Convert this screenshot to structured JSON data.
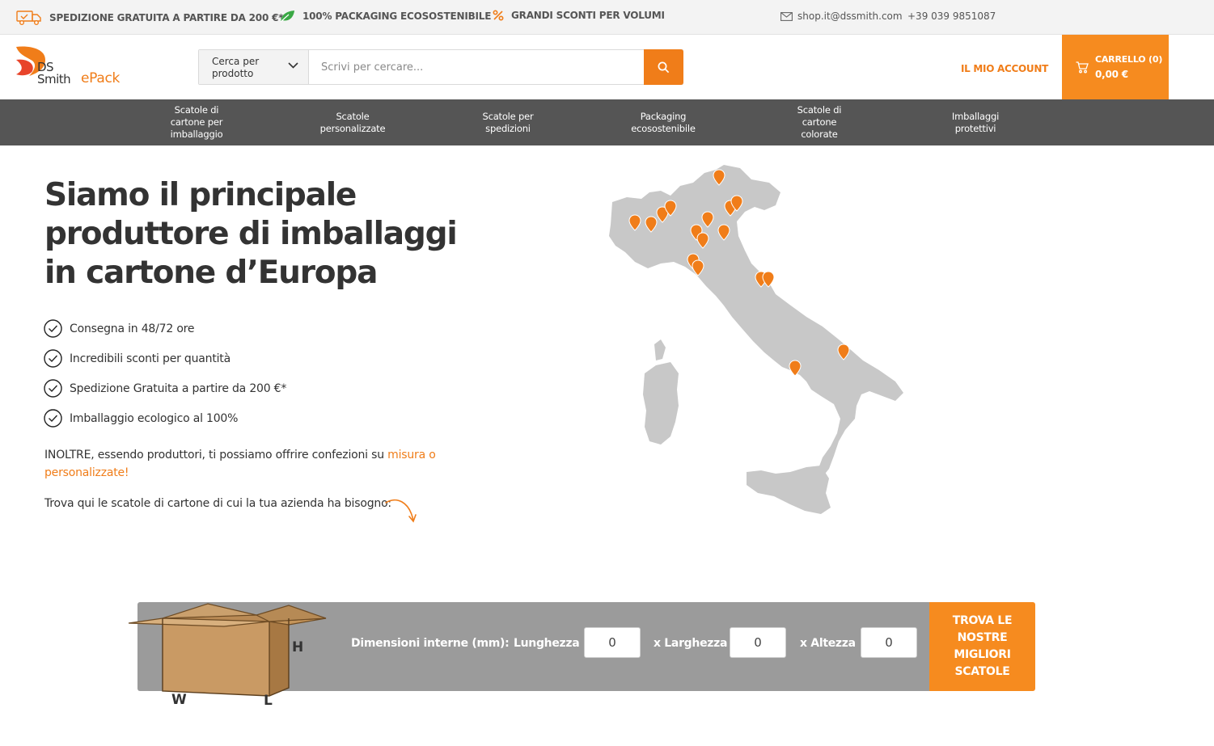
{
  "topbar": {
    "shipping": "SPEDIZIONE GRATUITA A PARTIRE DA 200 €*",
    "eco": "100% PACKAGING ECOSOSTENIBILE",
    "discount": "GRANDI SCONTI PER VOLUMI",
    "email": "shop.it@dssmith.com",
    "phone": "+39 039 9851087"
  },
  "logo": {
    "ds": "DS",
    "smith": "Smith",
    "epack": "ePack"
  },
  "search": {
    "category_line1": "Cerca per",
    "category_line2": "prodotto",
    "placeholder": "Scrivi per cercare..."
  },
  "header": {
    "account": "IL MIO ACCOUNT",
    "cart_label": "CARRELLO (0)",
    "cart_total": "0,00 €"
  },
  "nav": [
    {
      "label": "Scatole di\ncartone per\nimballaggio"
    },
    {
      "label": "Scatole\npersonalizzate"
    },
    {
      "label": "Scatole per\nspedizioni"
    },
    {
      "label": "Packaging\necosostenibile"
    },
    {
      "label": "Scatole di\ncartone\ncolorate"
    },
    {
      "label": "Imballaggi\nprotettivi"
    }
  ],
  "hero": {
    "title": "Siamo il principale produttore di imballaggi in cartone d’Europa",
    "features": [
      "Consegna in 48/72 ore",
      "Incredibili sconti per quantità",
      "Spedizione Gratuita a partire da 200 €*",
      "Imballaggio ecologico al 100%"
    ],
    "para1_text": "INOLTRE, essendo produttori, ti possiamo offrire confezioni su ",
    "para1_link": "misura o personalizzate!",
    "para2": "Trova qui le scatole di cartone di cui la tua azienda ha bisogno:"
  },
  "dimensions": {
    "label": "Dimensioni interne (mm):",
    "length_label": "Lunghezza",
    "width_label": "x Larghezza",
    "height_label": "x Altezza",
    "length_value": "0",
    "width_value": "0",
    "height_value": "0",
    "button": "TROVA LE NOSTRE MIGLIORI SCATOLE",
    "box_h": "H",
    "box_w": "W",
    "box_l": "L"
  },
  "colors": {
    "accent": "#f07d19",
    "nav_bg": "#555555",
    "dim_bg": "#9b9b9b",
    "map_fill": "#c8c8c8"
  }
}
